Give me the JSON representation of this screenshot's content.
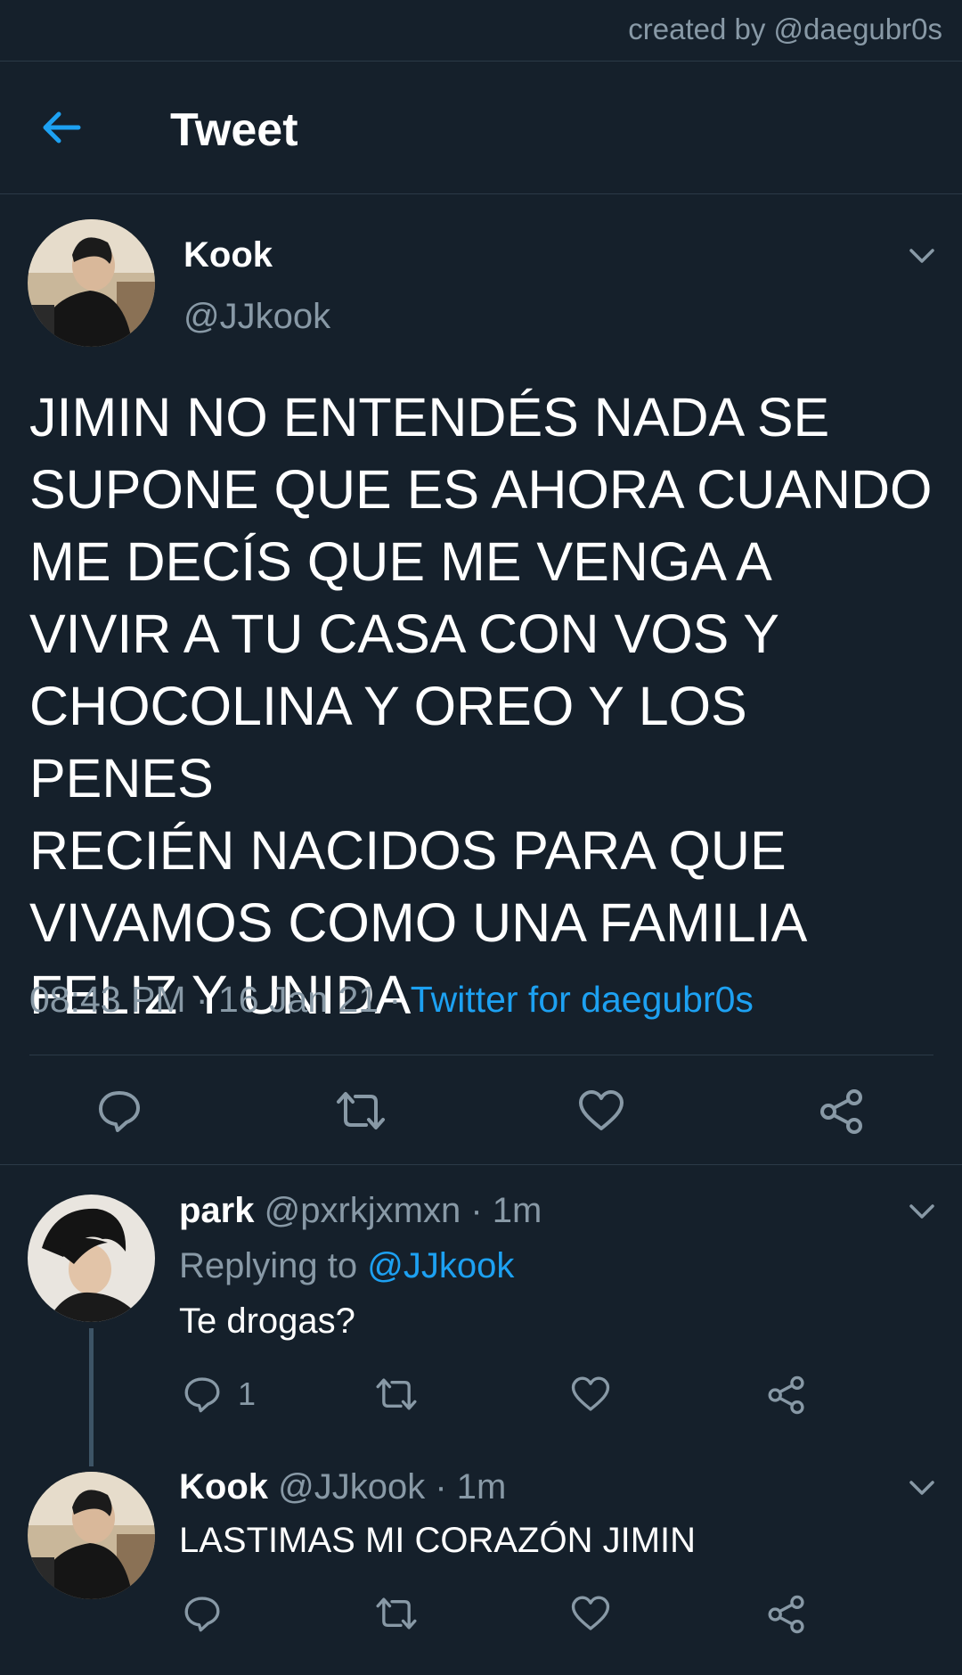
{
  "credit": "created by @daegubr0s",
  "header": {
    "title": "Tweet"
  },
  "tweet": {
    "name": "Kook",
    "handle": "@JJkook",
    "text": "JIMIN NO ENTENDÉS NADA SE\nSUPONE QUE ES AHORA CUANDO\nME DECÍS QUE ME VENGA A\nVIVIR A TU CASA CON VOS Y\nCHOCOLINA Y OREO Y LOS PENES\nRECIÉN NACIDOS PARA QUE\nVIVAMOS COMO UNA FAMILIA\nFELIZ Y UNIDA",
    "time": "08:43 PM",
    "date": "16 Jan 21",
    "sep": "·",
    "source": "Twitter for daegubr0s"
  },
  "replies": [
    {
      "name": "park",
      "handle": "@pxrkjxmxn",
      "time": "· 1m",
      "replying_label": "Replying to",
      "replying_to": "@JJkook",
      "text": "Te drogas?",
      "reply_count": "1"
    },
    {
      "name": "Kook",
      "handle": "@JJkook",
      "time": "· 1m",
      "text": "LASTIMAS MI CORAZÓN JIMIN"
    }
  ],
  "icons": {
    "back": "arrow-left-icon",
    "more": "chevron-down-icon",
    "reply": "speech-bubble-icon",
    "retweet": "retweet-icon",
    "like": "heart-icon",
    "share": "share-icon"
  },
  "colors": {
    "background": "#15202b",
    "accent": "#1da1f2",
    "secondary_text": "#8899a6",
    "divider": "#2b3a47"
  }
}
